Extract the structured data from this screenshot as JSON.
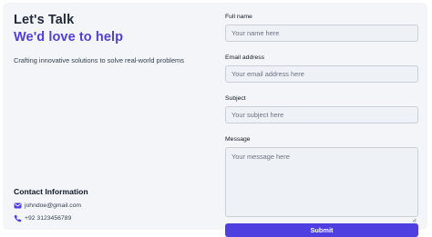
{
  "hero": {
    "title": "Let's Talk",
    "subtitle": "We'd love to help",
    "tagline": "Crafting innovative solutions to solve real-world problems"
  },
  "contact": {
    "title": "Contact Information",
    "email": "johndoe@gmail.com",
    "phone": "+92 3123456789",
    "email_icon": "mail-icon",
    "phone_icon": "phone-icon"
  },
  "form": {
    "name_label": "Full name",
    "name_placeholder": "Your name here",
    "email_label": "Email address",
    "email_placeholder": "Your email address here",
    "subject_label": "Subject",
    "subject_placeholder": "Your subject here",
    "message_label": "Message",
    "message_placeholder": "Your message here",
    "submit_label": "Submit"
  },
  "colors": {
    "accent": "#4f3fe0",
    "card_background": "#f3f5f9",
    "input_background": "#eef1f6",
    "heading": "#1f2937"
  }
}
